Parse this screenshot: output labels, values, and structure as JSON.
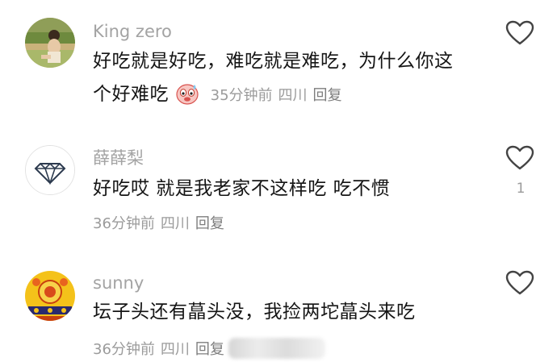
{
  "comments": [
    {
      "username": "King zero",
      "line1": "好吃就是好吃，难吃就是难吃，为什么你这",
      "line2": "个好难吃",
      "time": "35分钟前",
      "location": "四川",
      "reply": "回复",
      "likes": "",
      "avatar_icon": "photo-avatar",
      "emoji_icon": "sweating-face-emoji"
    },
    {
      "username": "薛薛梨",
      "line1": "好吃哎 就是我老家不这样吃 吃不惯",
      "time": "36分钟前",
      "location": "四川",
      "reply": "回复",
      "likes": "1",
      "avatar_icon": "diamond-avatar"
    },
    {
      "username": "sunny",
      "line1": "坛子头还有蕌头没，我捡两坨蕌头来吃",
      "time": "36分钟前",
      "location": "四川",
      "reply": "回复",
      "likes": "",
      "avatar_icon": "golden-pattern-avatar"
    }
  ],
  "icons": {
    "like": "heart-outline-icon"
  },
  "colors": {
    "username": "#a3a3a3",
    "content": "#151515",
    "meta": "#9b9b9b",
    "heart_stroke": "#444444"
  }
}
